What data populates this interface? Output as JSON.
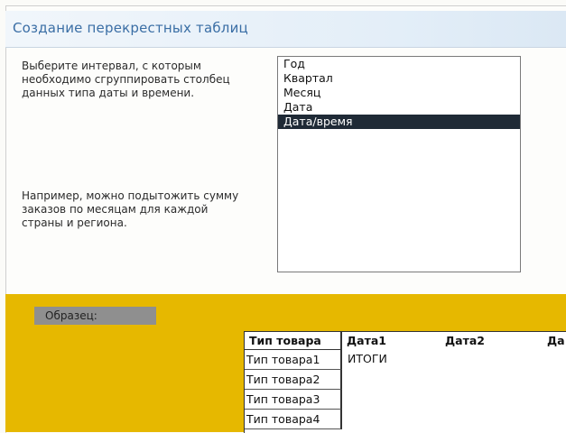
{
  "window": {
    "title": "Создание перекрестных таблиц"
  },
  "description": "Выберите интервал, с которым\nнеобходимо сгруппировать столбец\nданных типа даты и времени.",
  "example": "Например, можно подытожить сумму\n заказов по месяцам для каждой\nстраны и региона.",
  "interval_list": {
    "items": [
      "Год",
      "Квартал",
      "Месяц",
      "Дата",
      "Дата/время"
    ],
    "selected": "Дата/время"
  },
  "sample": {
    "label": "Образец:",
    "headers": [
      "Тип товара",
      "Дата1",
      "Дата2",
      "Да"
    ],
    "rows": [
      "Тип товара1",
      "Тип товара2",
      "Тип товара3",
      "Тип товара4"
    ],
    "total": "ИТОГИ"
  },
  "colors": {
    "title": "#3a6ea5",
    "sample_bg": "#e6b800",
    "selection": "#1f2a36"
  }
}
